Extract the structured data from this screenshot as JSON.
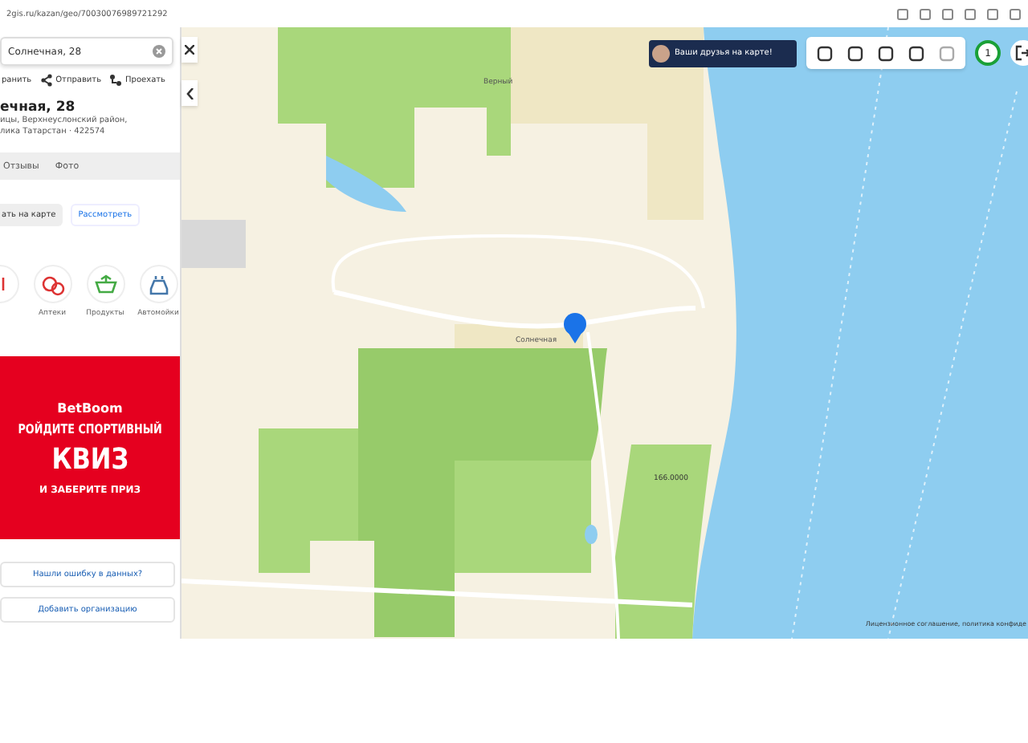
{
  "browser": {
    "url": "2gis.ru/kazan/geo/70030076989721292"
  },
  "panel": {
    "search": {
      "value": "Солнечная, 28"
    },
    "actions": [
      {
        "label": "ранить"
      },
      {
        "label": "Отправить"
      },
      {
        "label": "Проехать"
      }
    ],
    "title": "ечная, 28",
    "address": [
      "ицы, Верхнеуслонский район,",
      "лика Татарстан · 422574"
    ],
    "tabs": [
      {
        "label": "Отзывы",
        "selected": false
      },
      {
        "label": "Фото",
        "selected": false
      }
    ],
    "buttons": [
      {
        "label": "ать на карте",
        "kind": "filled"
      },
      {
        "label": "Рассмотреть",
        "kind": "plain"
      }
    ],
    "categories": [
      {
        "kind": "partial"
      },
      {
        "label": "Аптеки",
        "kind": "pharmacy"
      },
      {
        "label": "Продукты",
        "kind": "basket"
      },
      {
        "label": "Автомойки",
        "kind": "carwash"
      }
    ],
    "ad": {
      "brand": "BetBoom",
      "line1": "РОЙДИТЕ СПОРТИВНЫЙ",
      "line2": "КВИЗ",
      "line3": "И ЗАБЕРИТЕ ПРИЗ"
    },
    "links": [
      "Нашли ошибку в данных?",
      "Добавить организацию"
    ]
  },
  "map": {
    "promo": "Ваши друзья на карте!",
    "counter": "1",
    "labels": [
      {
        "text": "Солнечная",
        "kind": "street"
      },
      {
        "text": "Верный",
        "kind": "place"
      },
      {
        "text": "166.0000",
        "kind": "tag"
      }
    ],
    "footer": "Лицензионное соглашение, политика конфиде"
  }
}
